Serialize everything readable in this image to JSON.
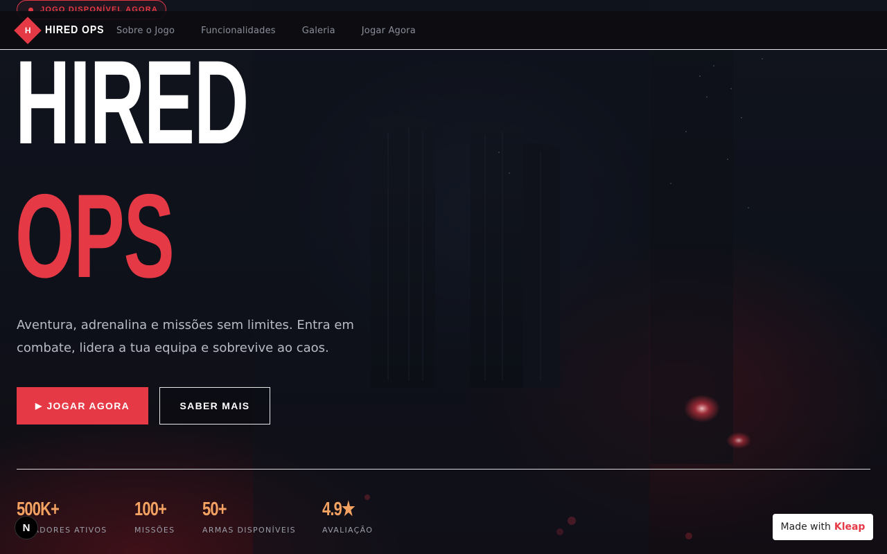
{
  "badge": {
    "text": "JOGO DISPONÍVEL AGORA"
  },
  "nav": {
    "logo_letter": "H",
    "brand": "HIRED OPS",
    "links": [
      "Sobre o Jogo",
      "Funcionalidades",
      "Galeria",
      "Jogar Agora"
    ]
  },
  "hero": {
    "title_line1": "HIRED",
    "title_line2": "OPS",
    "lead": "Aventura, adrenalina e missões sem limites. Entra em combate, lidera a tua equipa e sobrevive ao caos.",
    "cta_primary_icon": "▶",
    "cta_primary": "JOGAR AGORA",
    "cta_secondary": "SABER MAIS"
  },
  "stats": [
    {
      "value": "500K+",
      "label": "JOGADORES ATIVOS"
    },
    {
      "value": "100+",
      "label": "MISSÕES"
    },
    {
      "value": "50+",
      "label": "ARMAS DISPONÍVEIS"
    },
    {
      "value": "4.9★",
      "label": "AVALIAÇÃO"
    }
  ],
  "overlays": {
    "next_letter": "N",
    "made_with_prefix": "Made with",
    "made_with_brand": "Kleap"
  },
  "colors": {
    "accent": "#e63946",
    "stat": "#f4a261",
    "background": "#0c0e14"
  }
}
